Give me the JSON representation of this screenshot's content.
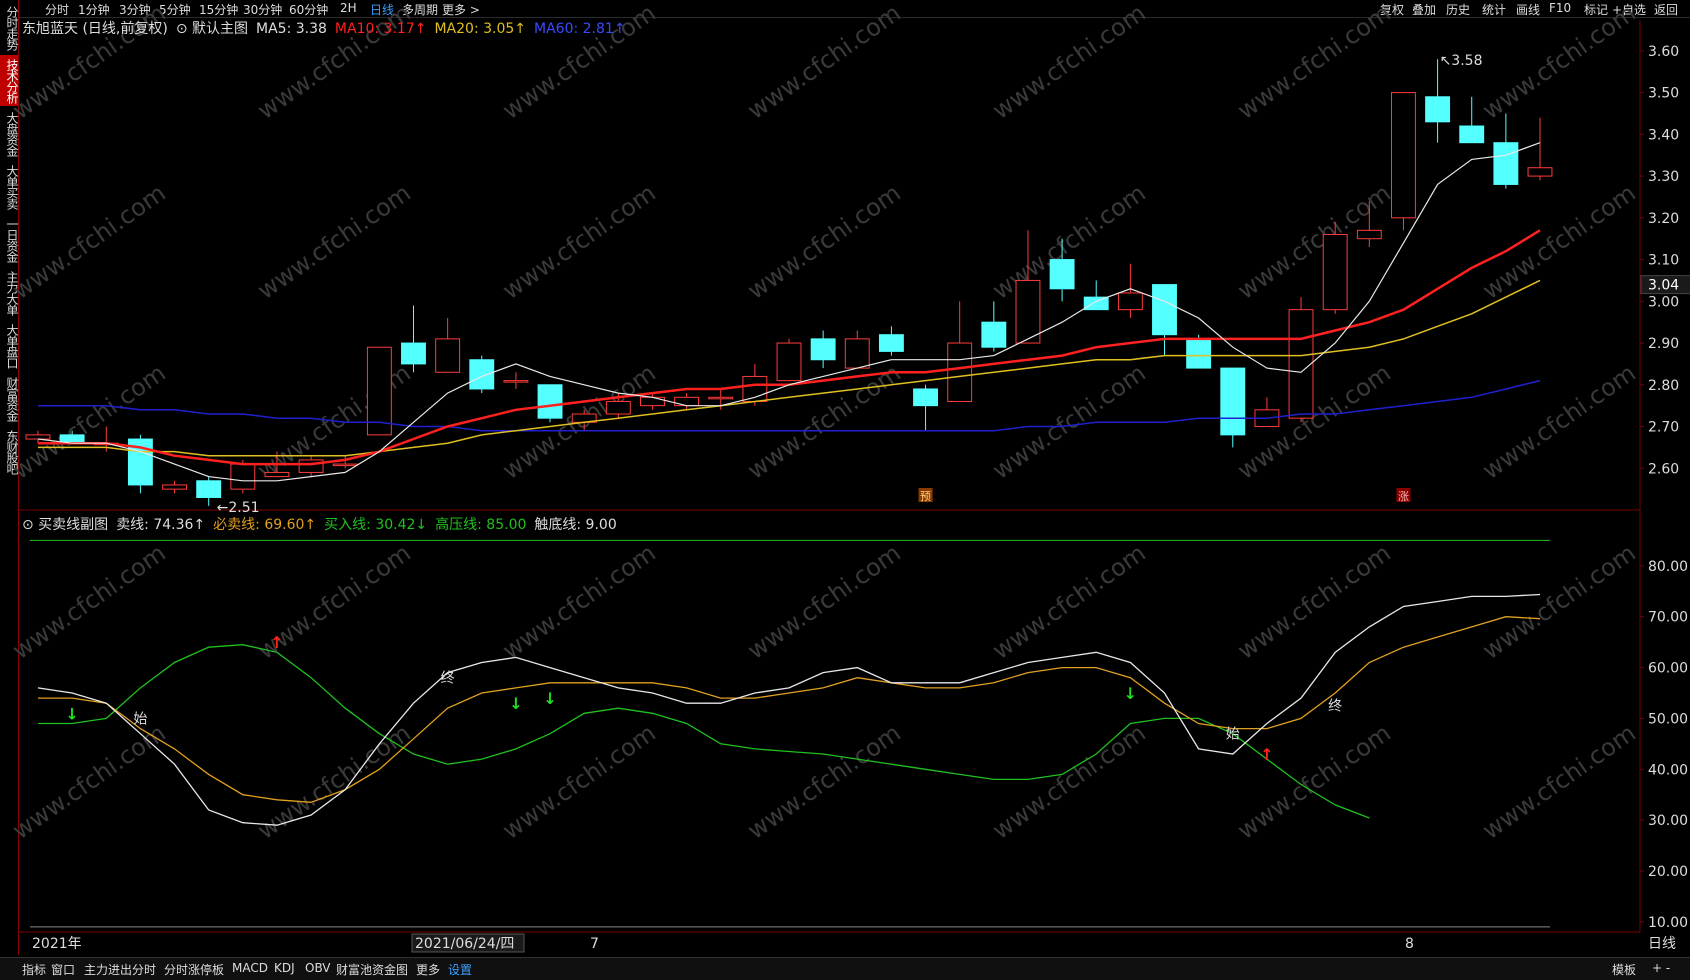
{
  "top_tabs": [
    "分时",
    "1分钟",
    "3分钟",
    "5分钟",
    "15分钟",
    "30分钟",
    "60分钟",
    "2H",
    "日线",
    "多周期",
    "更多 >"
  ],
  "active_top_tab": "日线",
  "top_right": [
    "复权",
    "叠加",
    "历史",
    "统计",
    "画线",
    "F10",
    "标记",
    "+自选",
    "返回"
  ],
  "side_tabs": [
    "分时走势",
    "技术分析",
    "大盘资金",
    "大单买卖",
    "一日资金",
    "主力大单",
    "大单盘口",
    "财富资金",
    "东财股吧"
  ],
  "active_side_tab": "技术分析",
  "main_legend": {
    "stock": "东旭蓝天 (日线,前复权)",
    "main_chart": "默认主图",
    "ma5": "MA5: 3.38",
    "ma10": "MA10: 3.17",
    "ma20": "MA20: 3.05",
    "ma60": "MA60: 2.81"
  },
  "sub_legend": {
    "name": "买卖线副图",
    "sell": "卖线: 74.36",
    "must_sell": "必卖线: 69.60",
    "buy": "买入线: 30.42",
    "high": "高压线: 85.00",
    "bottom": "触底线: 9.00"
  },
  "price_axis": [
    "3.60",
    "3.50",
    "3.40",
    "3.30",
    "3.20",
    "3.10",
    "3.00",
    "2.90",
    "2.80",
    "2.70",
    "2.60"
  ],
  "current_price": "3.04",
  "high_label": "3.58",
  "low_label": "2.51",
  "osc_axis": [
    "80.00",
    "70.00",
    "60.00",
    "50.00",
    "40.00",
    "30.00",
    "20.00",
    "10.00"
  ],
  "x_labels": [
    "2021年",
    "2021/06/24/四",
    "7",
    "8"
  ],
  "period_label": "日线",
  "markers": {
    "yu": "预",
    "zhang": "涨"
  },
  "annotations": {
    "start": "始",
    "end": "终"
  },
  "watermark": "www.cfchi.com",
  "bottom_tabs": [
    "指标",
    "窗口",
    "主力进出分时",
    "分时涨停板",
    "MACD",
    "KDJ",
    "OBV",
    "财富池资金图",
    "更多",
    "设置"
  ],
  "active_bottom_tab": "设置",
  "bottom_right": [
    "模板",
    "+ -"
  ],
  "colors": {
    "up": "#ff3b3b",
    "down": "#54ffff",
    "ma5": "#e8e8e8",
    "ma10": "#ff2020",
    "ma20": "#e0c020",
    "ma60": "#2020d0",
    "sell": "#e8e8e8",
    "must_sell": "#e0a020",
    "buy": "#20c020",
    "high": "#20c020"
  },
  "chart_data": {
    "type": "candlestick",
    "candles": [
      {
        "o": 2.67,
        "h": 2.69,
        "l": 2.66,
        "c": 2.68
      },
      {
        "o": 2.68,
        "h": 2.69,
        "l": 2.66,
        "c": 2.66
      },
      {
        "o": 2.66,
        "h": 2.7,
        "l": 2.64,
        "c": 2.66
      },
      {
        "o": 2.67,
        "h": 2.68,
        "l": 2.54,
        "c": 2.56
      },
      {
        "o": 2.55,
        "h": 2.57,
        "l": 2.54,
        "c": 2.56
      },
      {
        "o": 2.57,
        "h": 2.58,
        "l": 2.51,
        "c": 2.53
      },
      {
        "o": 2.55,
        "h": 2.62,
        "l": 2.54,
        "c": 2.61
      },
      {
        "o": 2.58,
        "h": 2.64,
        "l": 2.58,
        "c": 2.59
      },
      {
        "o": 2.59,
        "h": 2.63,
        "l": 2.58,
        "c": 2.62
      },
      {
        "o": 2.61,
        "h": 2.63,
        "l": 2.6,
        "c": 2.61
      },
      {
        "o": 2.68,
        "h": 2.89,
        "l": 2.68,
        "c": 2.89
      },
      {
        "o": 2.9,
        "h": 2.99,
        "l": 2.83,
        "c": 2.85
      },
      {
        "o": 2.83,
        "h": 2.96,
        "l": 2.83,
        "c": 2.91
      },
      {
        "o": 2.86,
        "h": 2.87,
        "l": 2.78,
        "c": 2.79
      },
      {
        "o": 2.81,
        "h": 2.83,
        "l": 2.79,
        "c": 2.81
      },
      {
        "o": 2.8,
        "h": 2.8,
        "l": 2.71,
        "c": 2.72
      },
      {
        "o": 2.71,
        "h": 2.74,
        "l": 2.69,
        "c": 2.73
      },
      {
        "o": 2.73,
        "h": 2.78,
        "l": 2.72,
        "c": 2.76
      },
      {
        "o": 2.75,
        "h": 2.78,
        "l": 2.74,
        "c": 2.77
      },
      {
        "o": 2.75,
        "h": 2.78,
        "l": 2.74,
        "c": 2.77
      },
      {
        "o": 2.77,
        "h": 2.79,
        "l": 2.74,
        "c": 2.77
      },
      {
        "o": 2.76,
        "h": 2.85,
        "l": 2.75,
        "c": 2.82
      },
      {
        "o": 2.81,
        "h": 2.91,
        "l": 2.81,
        "c": 2.9
      },
      {
        "o": 2.91,
        "h": 2.93,
        "l": 2.84,
        "c": 2.86
      },
      {
        "o": 2.84,
        "h": 2.93,
        "l": 2.84,
        "c": 2.91
      },
      {
        "o": 2.92,
        "h": 2.94,
        "l": 2.87,
        "c": 2.88
      },
      {
        "o": 2.79,
        "h": 2.8,
        "l": 2.69,
        "c": 2.75
      },
      {
        "o": 2.76,
        "h": 3.0,
        "l": 2.76,
        "c": 2.9
      },
      {
        "o": 2.95,
        "h": 3.0,
        "l": 2.88,
        "c": 2.89
      },
      {
        "o": 2.9,
        "h": 3.17,
        "l": 2.9,
        "c": 3.05
      },
      {
        "o": 3.1,
        "h": 3.15,
        "l": 3.0,
        "c": 3.03
      },
      {
        "o": 3.01,
        "h": 3.05,
        "l": 2.98,
        "c": 2.98
      },
      {
        "o": 2.98,
        "h": 3.09,
        "l": 2.96,
        "c": 3.02
      },
      {
        "o": 3.04,
        "h": 3.04,
        "l": 2.87,
        "c": 2.92
      },
      {
        "o": 2.91,
        "h": 2.92,
        "l": 2.84,
        "c": 2.84
      },
      {
        "o": 2.84,
        "h": 2.84,
        "l": 2.65,
        "c": 2.68
      },
      {
        "o": 2.7,
        "h": 2.77,
        "l": 2.7,
        "c": 2.74
      },
      {
        "o": 2.72,
        "h": 3.01,
        "l": 2.71,
        "c": 2.98
      },
      {
        "o": 2.98,
        "h": 3.19,
        "l": 2.97,
        "c": 3.16
      },
      {
        "o": 3.15,
        "h": 3.24,
        "l": 3.13,
        "c": 3.17
      },
      {
        "o": 3.2,
        "h": 3.5,
        "l": 3.17,
        "c": 3.5
      },
      {
        "o": 3.49,
        "h": 3.58,
        "l": 3.38,
        "c": 3.43
      },
      {
        "o": 3.42,
        "h": 3.49,
        "l": 3.38,
        "c": 3.38
      },
      {
        "o": 3.38,
        "h": 3.45,
        "l": 3.27,
        "c": 3.28
      },
      {
        "o": 3.3,
        "h": 3.44,
        "l": 3.29,
        "c": 3.32
      }
    ],
    "ma5": [
      2.67,
      2.66,
      2.66,
      2.64,
      2.61,
      2.58,
      2.57,
      2.57,
      2.58,
      2.59,
      2.64,
      2.71,
      2.78,
      2.82,
      2.85,
      2.82,
      2.8,
      2.78,
      2.77,
      2.75,
      2.75,
      2.77,
      2.8,
      2.82,
      2.84,
      2.86,
      2.86,
      2.86,
      2.87,
      2.91,
      2.95,
      3.0,
      3.03,
      3.0,
      2.96,
      2.89,
      2.84,
      2.83,
      2.9,
      3.0,
      3.14,
      3.28,
      3.34,
      3.35,
      3.38
    ],
    "ma10": [
      2.66,
      2.66,
      2.66,
      2.65,
      2.63,
      2.62,
      2.61,
      2.61,
      2.61,
      2.62,
      2.64,
      2.67,
      2.7,
      2.72,
      2.74,
      2.75,
      2.76,
      2.77,
      2.78,
      2.79,
      2.79,
      2.8,
      2.8,
      2.81,
      2.82,
      2.83,
      2.83,
      2.84,
      2.85,
      2.86,
      2.87,
      2.89,
      2.9,
      2.91,
      2.91,
      2.91,
      2.91,
      2.91,
      2.93,
      2.95,
      2.98,
      3.03,
      3.08,
      3.12,
      3.17
    ],
    "ma20": [
      2.65,
      2.65,
      2.65,
      2.64,
      2.64,
      2.63,
      2.63,
      2.63,
      2.63,
      2.63,
      2.64,
      2.65,
      2.66,
      2.68,
      2.69,
      2.7,
      2.71,
      2.72,
      2.73,
      2.74,
      2.75,
      2.76,
      2.77,
      2.78,
      2.79,
      2.8,
      2.81,
      2.82,
      2.83,
      2.84,
      2.85,
      2.86,
      2.86,
      2.87,
      2.87,
      2.87,
      2.87,
      2.87,
      2.88,
      2.89,
      2.91,
      2.94,
      2.97,
      3.01,
      3.05
    ],
    "ma60": [
      2.75,
      2.75,
      2.75,
      2.74,
      2.74,
      2.73,
      2.73,
      2.72,
      2.72,
      2.71,
      2.71,
      2.7,
      2.7,
      2.69,
      2.69,
      2.69,
      2.69,
      2.69,
      2.69,
      2.69,
      2.69,
      2.69,
      2.69,
      2.69,
      2.69,
      2.69,
      2.69,
      2.69,
      2.69,
      2.7,
      2.7,
      2.71,
      2.71,
      2.71,
      2.72,
      2.72,
      2.72,
      2.73,
      2.73,
      2.74,
      2.75,
      2.76,
      2.77,
      2.79,
      2.81
    ],
    "sell_line": [
      56,
      55,
      53,
      47,
      41,
      32,
      29.5,
      29,
      31,
      36,
      45,
      53,
      59,
      61,
      62,
      60,
      58,
      56,
      55,
      53,
      53,
      55,
      56,
      59,
      60,
      57,
      57,
      57,
      59,
      61,
      62,
      63,
      61,
      55,
      44,
      43,
      49,
      54,
      63,
      68,
      72,
      73,
      74,
      74,
      74.36
    ],
    "must_sell_line": [
      54,
      54,
      53,
      48,
      44,
      39,
      35,
      34,
      33.5,
      36,
      40,
      46,
      52,
      55,
      56,
      57,
      57,
      57,
      57,
      56,
      54,
      54,
      55,
      56,
      58,
      57,
      56,
      56,
      57,
      59,
      60,
      60,
      58,
      53,
      49,
      48,
      48,
      50,
      55,
      61,
      64,
      66,
      68,
      70,
      69.6
    ],
    "buy_line": [
      49,
      49,
      50,
      56,
      61,
      64,
      64.5,
      63,
      58,
      52,
      47,
      43,
      41,
      42,
      44,
      47,
      51,
      52,
      51,
      49,
      45,
      44,
      43.5,
      43,
      42,
      41,
      40,
      39,
      38,
      38,
      39,
      43,
      49,
      50,
      50,
      47,
      42,
      37,
      33,
      30.42
    ],
    "high_line": 85,
    "bottom_line": 9,
    "price_ylim": [
      2.5,
      3.65
    ],
    "osc_ylim": [
      8,
      90
    ]
  }
}
